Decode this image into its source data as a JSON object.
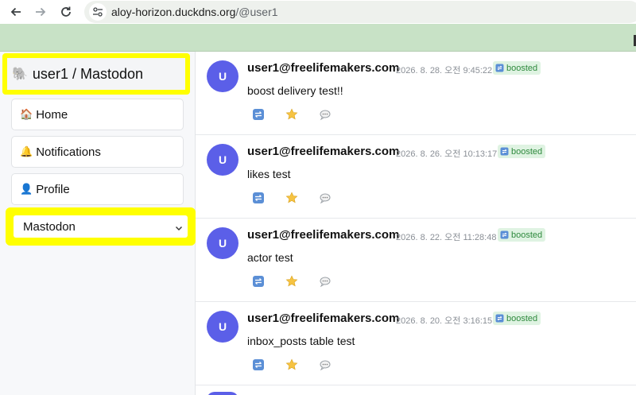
{
  "browser": {
    "url_host": "aloy-horizon.duckdns.org",
    "url_path": "/@user1"
  },
  "sidebar": {
    "brand_emoji": "🐘",
    "brand": "user1 / Mastodon",
    "items": [
      {
        "emoji": "🏠",
        "label": "Home"
      },
      {
        "emoji": "🔔",
        "label": "Notifications"
      },
      {
        "emoji": "👤",
        "label": "Profile"
      }
    ],
    "select_value": "Mastodon"
  },
  "feed": {
    "posts": [
      {
        "avatar": "U",
        "author": "user1@freelifemakers.com",
        "time": "2026. 8. 28. 오전 9:45:22",
        "badge": "boosted",
        "content": "boost delivery test!!"
      },
      {
        "avatar": "U",
        "author": "user1@freelifemakers.com",
        "time": "2026. 8. 26. 오전 10:13:17",
        "badge": "boosted",
        "content": "likes test"
      },
      {
        "avatar": "U",
        "author": "user1@freelifemakers.com",
        "time": "2026. 8. 22. 오전 11:28:48",
        "badge": "boosted",
        "content": "actor test"
      },
      {
        "avatar": "U",
        "author": "user1@freelifemakers.com",
        "time": "2026. 8. 20. 오전 3:16:15",
        "badge": "boosted",
        "content": "inbox_posts table test"
      }
    ]
  },
  "colors": {
    "accent_green_bar": "#c8e2c6",
    "highlight": "#ffff00",
    "avatar": "#5b5fe8",
    "badge_bg": "#dff3e2",
    "badge_text": "#2f8a3e"
  }
}
